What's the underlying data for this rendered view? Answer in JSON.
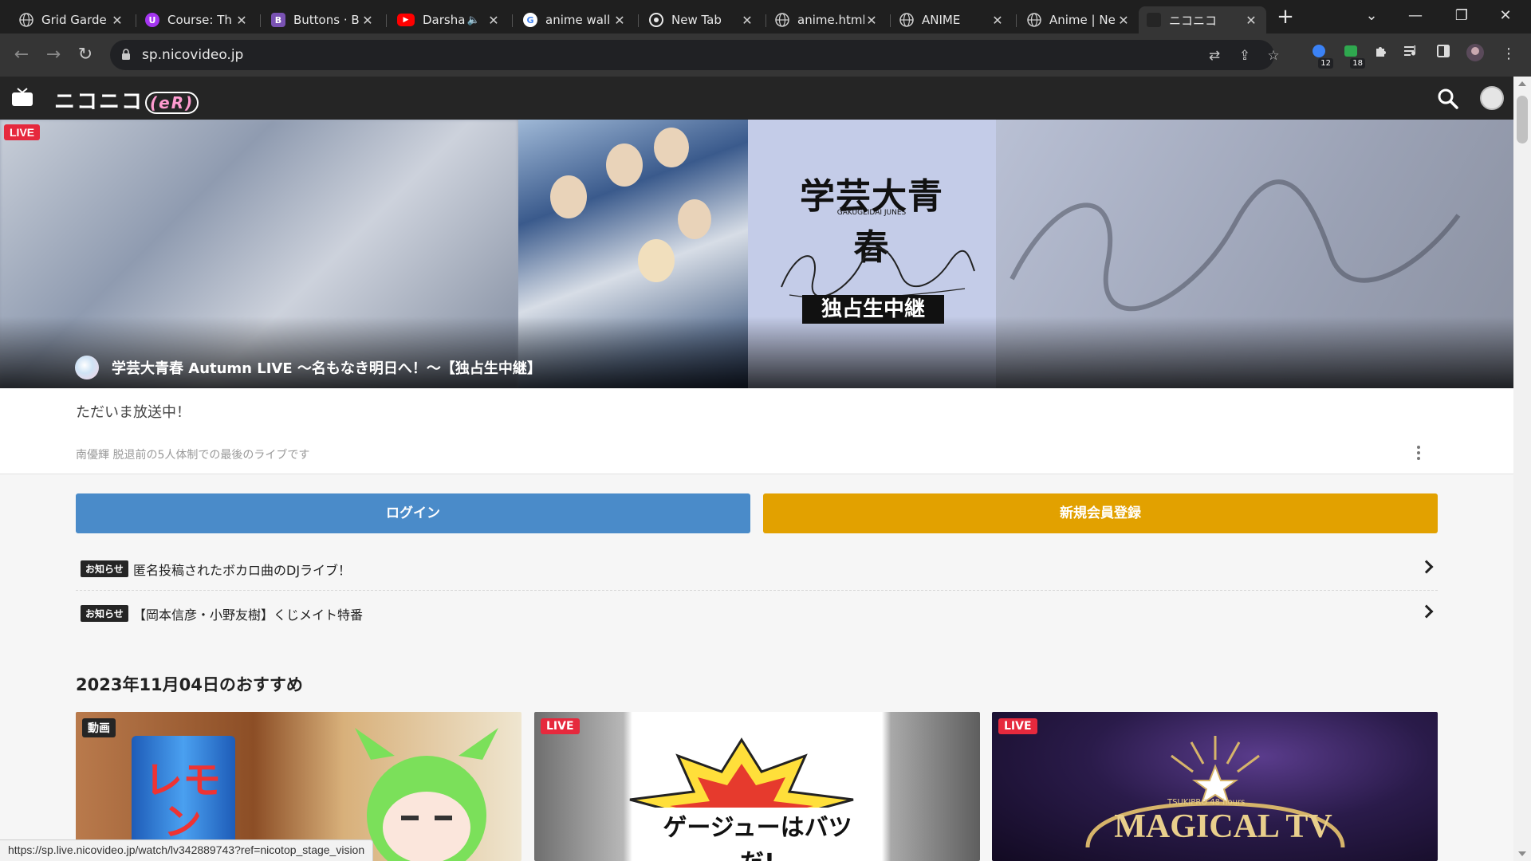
{
  "browser": {
    "tabs": [
      {
        "title": "Grid Garde",
        "icon": "globe-icon",
        "color": "#8a8a8a"
      },
      {
        "title": "Course: Th",
        "icon": "udemy-icon",
        "color": "#a435f0",
        "glyph": "U"
      },
      {
        "title": "Buttons · B",
        "icon": "bootstrap-icon",
        "color": "#7952b3",
        "glyph": "B"
      },
      {
        "title": "Darsha",
        "icon": "youtube-icon",
        "color": "#ff0000",
        "glyph": "▶",
        "audio": "🔈"
      },
      {
        "title": "anime wall",
        "icon": "google-icon",
        "color": "#4285f4",
        "glyph": "G"
      },
      {
        "title": "New Tab",
        "icon": "chrome-icon",
        "color": "#9aa0a6"
      },
      {
        "title": "anime.html",
        "icon": "globe-icon",
        "color": "#8a8a8a"
      },
      {
        "title": "ANIME",
        "icon": "globe-icon",
        "color": "#8a8a8a"
      },
      {
        "title": "Anime | Ne",
        "icon": "globe-icon",
        "color": "#8a8a8a"
      },
      {
        "title": "ニコニコ",
        "icon": "niconico-icon",
        "color": "#252525",
        "active": true
      }
    ],
    "new_tab": "+",
    "window_controls": {
      "dropdown": "⌄",
      "minimize": "—",
      "restore": "❐",
      "close": "✕"
    },
    "nav": {
      "back": "←",
      "forward": "→",
      "reload": "↻"
    },
    "url": "sp.nicovideo.jp",
    "extensions": [
      {
        "icon": "extension-blue-icon",
        "badge": "12",
        "color": "#3b82f6"
      },
      {
        "icon": "extension-green-icon",
        "badge": "18",
        "color": "#2fa84f"
      }
    ],
    "status_url": "https://sp.live.nicovideo.jp/watch/lv342889743?ref=nicotop_stage_vision"
  },
  "site": {
    "logo_text": "ニコニコ",
    "logo_suffix": "(eR)"
  },
  "hero": {
    "badge": "LIVE",
    "art_title": "学芸大青春",
    "art_sub": "GAKUGEIDAI JUNES",
    "art_banner": "独占生中継",
    "title": "学芸大青春 Autumn LIVE ～名もなき明日へ！～【独占生中継】"
  },
  "description": {
    "on_air": "ただいま放送中！",
    "sub": "南優輝 脱退前の5人体制での最後のライブです"
  },
  "buttons": {
    "login": "ログイン",
    "signup": "新規会員登録"
  },
  "news": [
    {
      "tag": "お知らせ",
      "text": "匿名投稿されたボカロ曲のDJライブ！"
    },
    {
      "tag": "お知らせ",
      "text": "【岡本信彦・小野友樹】くじメイト特番"
    }
  ],
  "recommend": {
    "title": "2023年11月04日のおすすめ",
    "cards": [
      {
        "tag": "動画",
        "tag_color": "#252525",
        "can_text": "レモン"
      },
      {
        "tag": "LIVE",
        "tag_color": "#e6293d",
        "burst_text": "ゲージューはバツだ!"
      },
      {
        "tag": "LIVE",
        "tag_color": "#e6293d",
        "logo_text": "MAGICAL TV",
        "logo_sub": "TSUKIPRO 48 hours"
      }
    ]
  }
}
